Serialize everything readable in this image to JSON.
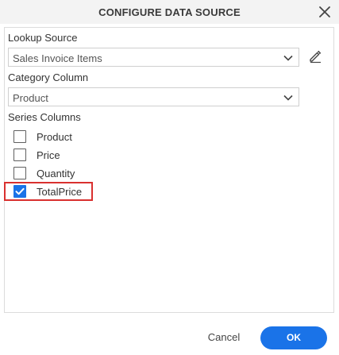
{
  "dialog": {
    "title": "CONFIGURE DATA SOURCE",
    "close_icon": "close-icon"
  },
  "lookup_source": {
    "label": "Lookup Source",
    "selected": "Sales Invoice Items",
    "edit_icon": "pencil-icon"
  },
  "category_column": {
    "label": "Category Column",
    "selected": "Product"
  },
  "series_columns": {
    "label": "Series Columns",
    "items": [
      {
        "label": "Product",
        "checked": false
      },
      {
        "label": "Price",
        "checked": false
      },
      {
        "label": "Quantity",
        "checked": false
      },
      {
        "label": "TotalPrice",
        "checked": true
      }
    ]
  },
  "footer": {
    "cancel_label": "Cancel",
    "ok_label": "OK"
  },
  "colors": {
    "accent": "#1a73e8",
    "highlight": "#d9302f",
    "header_bg": "#f3f3f3"
  }
}
